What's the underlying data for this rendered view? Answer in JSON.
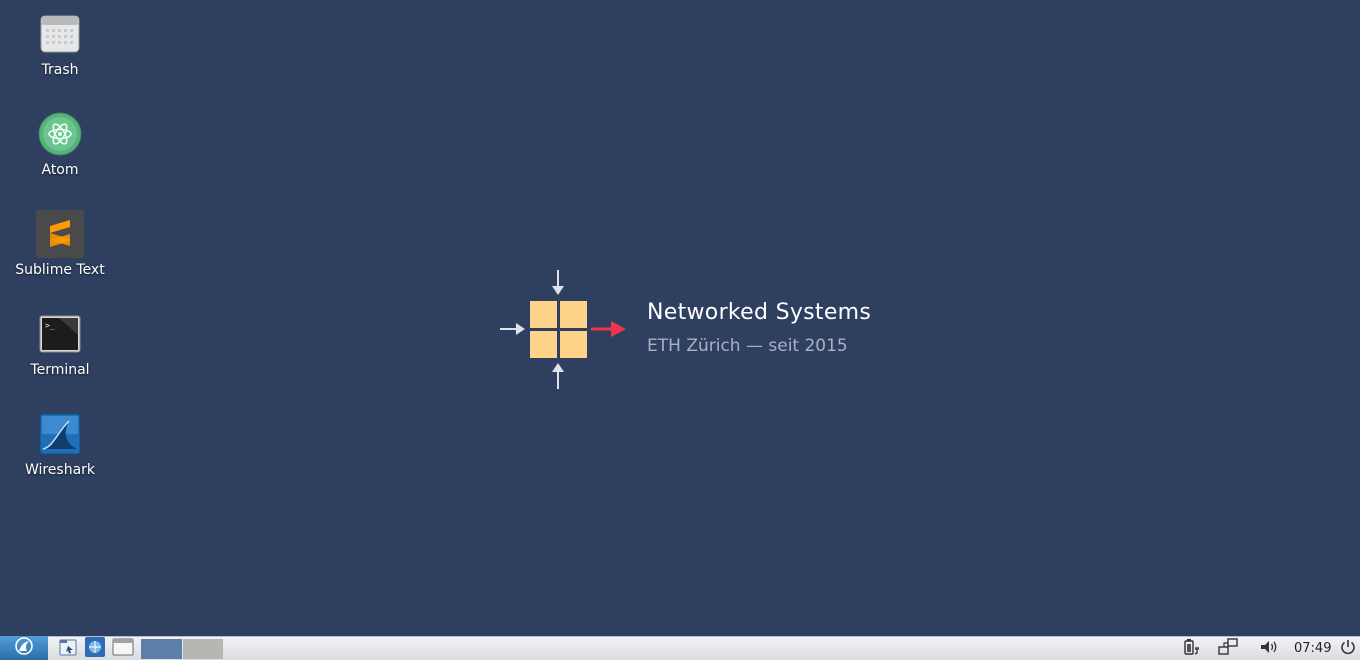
{
  "desktop": {
    "icons": [
      {
        "label": "Trash",
        "icon": "trash-icon"
      },
      {
        "label": "Atom",
        "icon": "atom-icon"
      },
      {
        "label": "Sublime Text",
        "icon": "sublime-text-icon"
      },
      {
        "label": "Terminal",
        "icon": "terminal-icon"
      },
      {
        "label": "Wireshark",
        "icon": "wireshark-icon"
      }
    ]
  },
  "brand": {
    "title": "Networked Systems",
    "subtitle": "ETH Zürich  —  seit 2015",
    "colors": {
      "tile": "#ffd48a",
      "arrow_in": "#dfe3ea",
      "arrow_out": "#f0364f"
    }
  },
  "taskbar": {
    "launchers": [
      "start-menu-icon",
      "file-manager-icon",
      "network-icon",
      "window-icon"
    ],
    "workspaces": [
      {
        "active": true
      },
      {
        "active": false
      }
    ],
    "tray": [
      "battery-plug-icon",
      "network-connections-icon",
      "volume-icon"
    ],
    "clock": "07:49",
    "power": "power-icon"
  },
  "colors": {
    "desktop_bg": "#2e3f60",
    "taskbar_bg": "#e4e6ea",
    "workspace_active": "#5b7fa6"
  }
}
